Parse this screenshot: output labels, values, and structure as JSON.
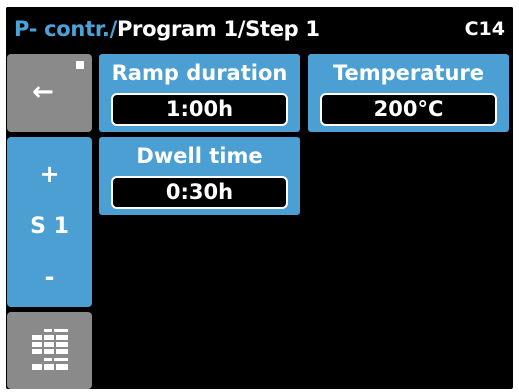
{
  "header": {
    "prefix": "P- contr.",
    "separator": "/",
    "path": "Program 1/Step 1",
    "code": "C14"
  },
  "sidebar": {
    "back_icon": "left-arrow-icon",
    "back_glyph": "←",
    "step_up": "+",
    "step_label": "S 1",
    "step_down": "-",
    "grid_icon": "table-grid-icon"
  },
  "params": {
    "ramp": {
      "label": "Ramp duration",
      "value": "1:00h"
    },
    "temperature": {
      "label": "Temperature",
      "value": "200°C"
    },
    "dwell": {
      "label": "Dwell time",
      "value": "0:30h"
    }
  },
  "colors": {
    "accent": "#4b9fd2",
    "button_gray": "#8a8a8a",
    "background": "#000000",
    "text": "#ffffff"
  }
}
